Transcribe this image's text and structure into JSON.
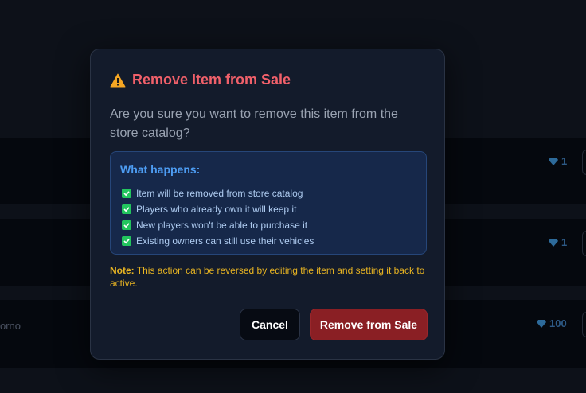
{
  "background": {
    "rows": [
      {
        "price": "1"
      },
      {
        "price": "1"
      },
      {
        "price": "100",
        "name_fragment": "orno"
      }
    ]
  },
  "modal": {
    "title": "Remove Item from Sale",
    "title_icon": "warning-icon",
    "message": "Are you sure you want to remove this item from the store catalog?",
    "info": {
      "heading": "What happens:",
      "items": [
        "Item will be removed from store catalog",
        "Players who already own it will keep it",
        "New players won't be able to purchase it",
        "Existing owners can still use their vehicles"
      ]
    },
    "note": {
      "label": "Note:",
      "text": " This action can be reversed by editing the item and setting it back to active."
    },
    "buttons": {
      "cancel": "Cancel",
      "remove": "Remove from Sale"
    }
  },
  "colors": {
    "title": "#f0606a",
    "info_heading": "#4d9cf2",
    "check": "#22c55e",
    "note": "#e8b422",
    "remove_button": "#8a1f24"
  }
}
